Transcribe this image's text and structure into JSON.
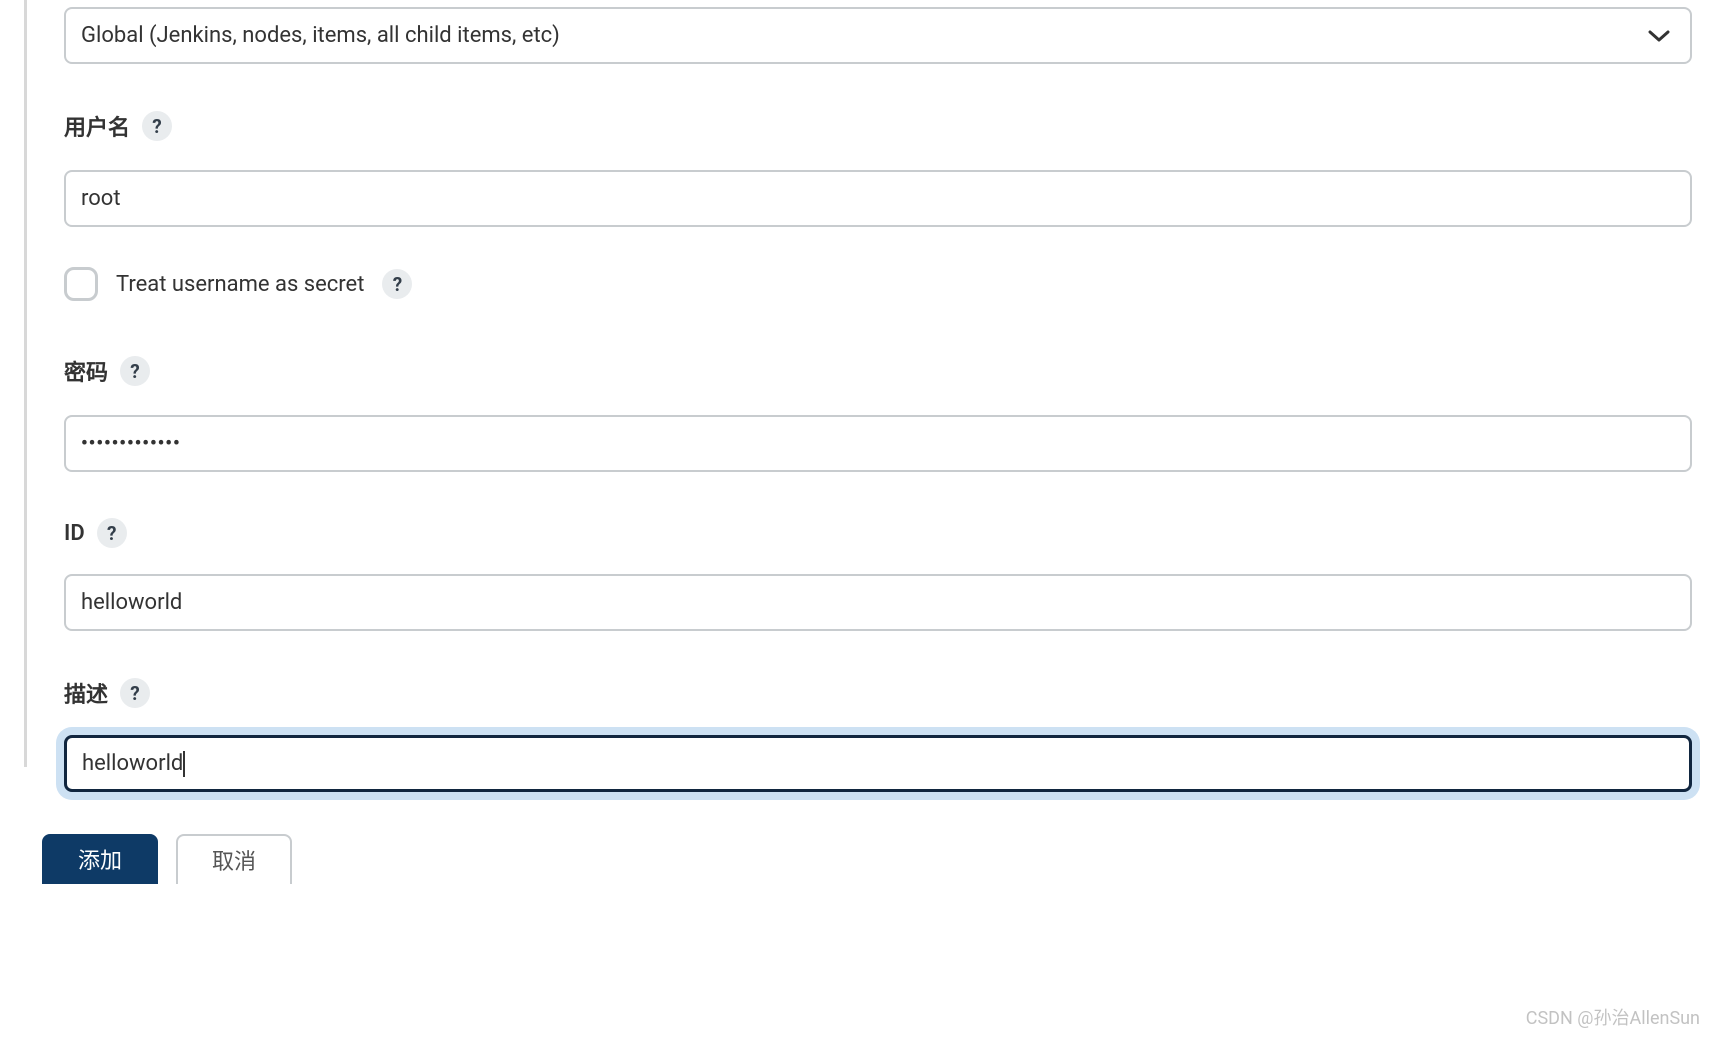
{
  "scope": {
    "selected": "Global (Jenkins, nodes, items, all child items, etc)"
  },
  "username": {
    "label": "用户名",
    "value": "root"
  },
  "treatSecret": {
    "label": "Treat username as secret",
    "checked": false
  },
  "password": {
    "label": "密码",
    "masked": "•••••••••••••"
  },
  "id": {
    "label": "ID",
    "value": "helloworld"
  },
  "description": {
    "label": "描述",
    "value": "helloworld"
  },
  "buttons": {
    "add": "添加",
    "cancel": "取消"
  },
  "helpGlyph": "?",
  "watermark": "CSDN @孙治AllenSun"
}
